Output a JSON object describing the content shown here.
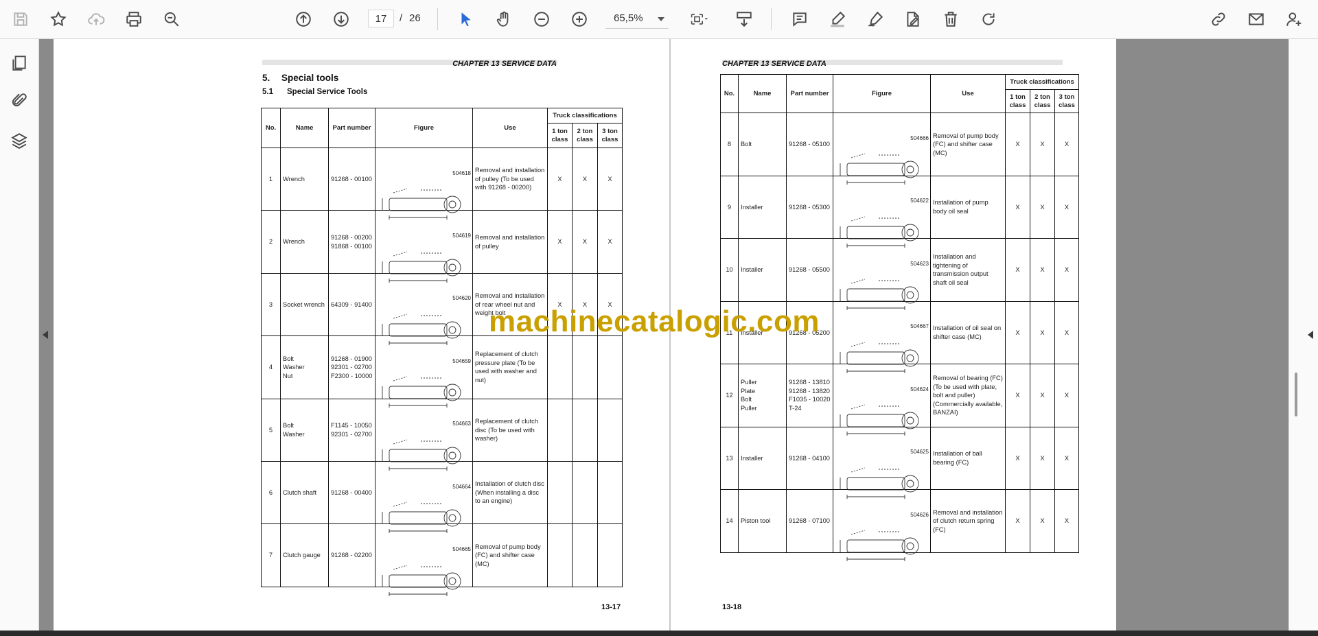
{
  "toolbar": {
    "current_page": "17",
    "separator": "/",
    "total_pages": "26",
    "zoom": "65,5%"
  },
  "watermark": "machinecatalogic.com",
  "page17": {
    "chapter": "CHAPTER 13 SERVICE DATA",
    "section_number": "5.",
    "section_title": "Special tools",
    "subsection_number": "5.1",
    "subsection_title": "Special Service Tools",
    "page_number": "13-17",
    "headers": {
      "no": "No.",
      "name": "Name",
      "part": "Part number",
      "figure": "Figure",
      "use": "Use",
      "truck": "Truck classifications",
      "c1": "1 ton class",
      "c2": "2 ton class",
      "c3": "3 ton class"
    },
    "rows": [
      {
        "no": "1",
        "name": "Wrench",
        "part": "91268 - 00100",
        "fig": "504618",
        "use": "Removal and installation of pulley (To be used with 91268 - 00200)",
        "c1": "X",
        "c2": "X",
        "c3": "X"
      },
      {
        "no": "2",
        "name": "Wrench",
        "part": "91268 - 00200\n91868 - 00100",
        "fig": "504619",
        "use": "Removal and installation of pulley",
        "c1": "X",
        "c2": "X",
        "c3": "X"
      },
      {
        "no": "3",
        "name": "Socket wrench",
        "part": "64309 - 91400",
        "fig": "504620",
        "use": "Removal and installation of rear wheel nut and weight bolt",
        "c1": "X",
        "c2": "X",
        "c3": "X"
      },
      {
        "no": "4",
        "name": "Bolt\nWasher\nNut",
        "part": "91268 - 01900\n92301 - 02700\nF2300 - 10000",
        "fig": "504659",
        "use": "Replacement of clutch pressure plate (To be used with washer and nut)",
        "c1": "",
        "c2": "",
        "c3": ""
      },
      {
        "no": "5",
        "name": "Bolt\nWasher",
        "part": "F1145 - 10050\n92301 - 02700",
        "fig": "504663",
        "use": "Replacement of clutch disc (To be used with washer)",
        "c1": "",
        "c2": "",
        "c3": ""
      },
      {
        "no": "6",
        "name": "Clutch shaft",
        "part": "91268 - 00400",
        "fig": "504664",
        "use": "Installation of clutch disc (When installing a disc to an engine)",
        "c1": "",
        "c2": "",
        "c3": ""
      },
      {
        "no": "7",
        "name": "Clutch gauge",
        "part": "91268 - 02200",
        "fig": "504665",
        "use": "Removal of pump body (FC) and shifter case (MC)",
        "c1": "",
        "c2": "",
        "c3": ""
      }
    ]
  },
  "page18": {
    "chapter": "CHAPTER 13 SERVICE DATA",
    "page_number": "13-18",
    "headers": {
      "no": "No.",
      "name": "Name",
      "part": "Part number",
      "figure": "Figure",
      "use": "Use",
      "truck": "Truck classifications",
      "c1": "1 ton class",
      "c2": "2 ton class",
      "c3": "3 ton class"
    },
    "rows": [
      {
        "no": "8",
        "name": "Bolt",
        "part": "91268 - 05100",
        "fig": "504666",
        "use": "Removal of pump body (FC) and shifter case (MC)",
        "c1": "X",
        "c2": "X",
        "c3": "X"
      },
      {
        "no": "9",
        "name": "Installer",
        "part": "91268 - 05300",
        "fig": "504622",
        "use": "Installation of pump body oil seal",
        "c1": "X",
        "c2": "X",
        "c3": "X"
      },
      {
        "no": "10",
        "name": "Installer",
        "part": "91268 - 05500",
        "fig": "504623",
        "use": "Installation and tightening of transmission output shaft oil seal",
        "c1": "X",
        "c2": "X",
        "c3": "X"
      },
      {
        "no": "11",
        "name": "Installer",
        "part": "91268 - 05200",
        "fig": "504667",
        "use": "Installation of oil seal on shifter case (MC)",
        "c1": "X",
        "c2": "X",
        "c3": "X"
      },
      {
        "no": "12",
        "name": "Puller\nPlate\nBolt\nPuller",
        "part": "91268 - 13810\n91268 - 13820\nF1035 - 10020\nT-24",
        "fig": "504624",
        "use": "Removal of bearing (FC) (To be used with plate, bolt and puller) (Commercially available, BANZAI)",
        "c1": "X",
        "c2": "X",
        "c3": "X"
      },
      {
        "no": "13",
        "name": "Installer",
        "part": "91268 - 04100",
        "fig": "504625",
        "use": "Installation of ball bearing (FC)",
        "c1": "X",
        "c2": "X",
        "c3": "X"
      },
      {
        "no": "14",
        "name": "Piston tool",
        "part": "91268 - 07100",
        "fig": "504626",
        "use": "Removal and installation of clutch return spring (FC)",
        "c1": "X",
        "c2": "X",
        "c3": "X"
      }
    ]
  },
  "icons": [
    "save-icon",
    "bookmark-star-icon",
    "cloud-upload-icon",
    "print-icon",
    "zoom-search-icon",
    "page-up-icon",
    "page-down-icon",
    "select-arrow-icon",
    "hand-pan-icon",
    "zoom-out-icon",
    "zoom-in-icon",
    "fit-page-icon",
    "insert-page-icon",
    "comment-icon",
    "highlight-pen-icon",
    "draw-pen-icon",
    "sign-icon",
    "delete-icon",
    "redo-icon",
    "share-link-icon",
    "email-icon",
    "add-user-icon",
    "thumbnails-icon",
    "attachments-icon",
    "layers-icon"
  ],
  "colors": {
    "accent": "#2a6bd6",
    "watermark": "#c9a000",
    "viewer_bg": "#8a8a8a"
  }
}
